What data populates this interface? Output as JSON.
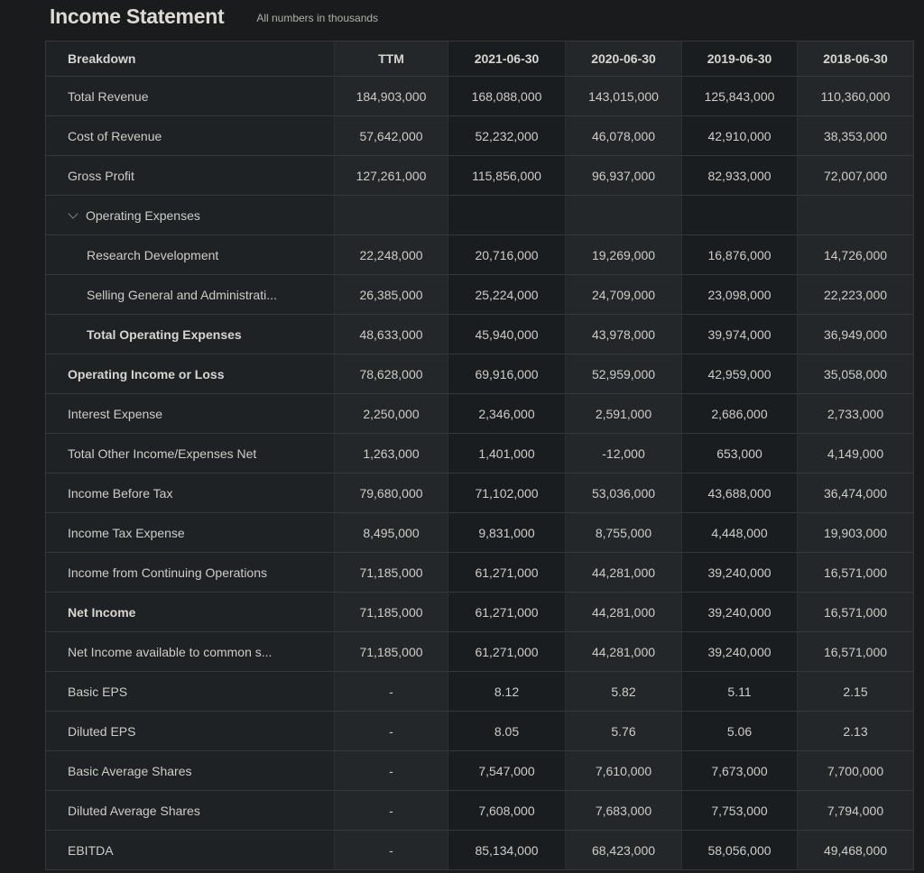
{
  "header": {
    "title": "Income Statement",
    "units_note": "All numbers in thousands"
  },
  "colors": {
    "page_background": "#191b1c",
    "column_shade_light": "#242729",
    "column_shade_dark": "#1a1d20",
    "label_column_background": "#1e2225",
    "row_divider": "#34383c",
    "text": "#cfccc6"
  },
  "icons": {
    "section_toggle": "chevron-down"
  },
  "table": {
    "columns": [
      "Breakdown",
      "TTM",
      "2021-06-30",
      "2020-06-30",
      "2019-06-30",
      "2018-06-30"
    ],
    "rows": [
      {
        "label": "Total Revenue",
        "style": "normal",
        "indent": 0,
        "values": [
          "184,903,000",
          "168,088,000",
          "143,015,000",
          "125,843,000",
          "110,360,000"
        ]
      },
      {
        "label": "Cost of Revenue",
        "style": "normal",
        "indent": 0,
        "values": [
          "57,642,000",
          "52,232,000",
          "46,078,000",
          "42,910,000",
          "38,353,000"
        ]
      },
      {
        "label": "Gross Profit",
        "style": "normal",
        "indent": 0,
        "values": [
          "127,261,000",
          "115,856,000",
          "96,937,000",
          "82,933,000",
          "72,007,000"
        ]
      },
      {
        "label": "Operating Expenses",
        "style": "section",
        "indent": 0,
        "values": [
          "",
          "",
          "",
          "",
          ""
        ]
      },
      {
        "label": "Research Development",
        "style": "normal",
        "indent": 1,
        "values": [
          "22,248,000",
          "20,716,000",
          "19,269,000",
          "16,876,000",
          "14,726,000"
        ]
      },
      {
        "label": "Selling General and Administrati...",
        "style": "normal",
        "indent": 1,
        "values": [
          "26,385,000",
          "25,224,000",
          "24,709,000",
          "23,098,000",
          "22,223,000"
        ]
      },
      {
        "label": "Total Operating Expenses",
        "style": "bold",
        "indent": 1,
        "values": [
          "48,633,000",
          "45,940,000",
          "43,978,000",
          "39,974,000",
          "36,949,000"
        ]
      },
      {
        "label": "Operating Income or Loss",
        "style": "bold",
        "indent": 0,
        "values": [
          "78,628,000",
          "69,916,000",
          "52,959,000",
          "42,959,000",
          "35,058,000"
        ]
      },
      {
        "label": "Interest Expense",
        "style": "normal",
        "indent": 0,
        "values": [
          "2,250,000",
          "2,346,000",
          "2,591,000",
          "2,686,000",
          "2,733,000"
        ]
      },
      {
        "label": "Total Other Income/Expenses Net",
        "style": "normal",
        "indent": 0,
        "values": [
          "1,263,000",
          "1,401,000",
          "-12,000",
          "653,000",
          "4,149,000"
        ]
      },
      {
        "label": "Income Before Tax",
        "style": "normal",
        "indent": 0,
        "values": [
          "79,680,000",
          "71,102,000",
          "53,036,000",
          "43,688,000",
          "36,474,000"
        ]
      },
      {
        "label": "Income Tax Expense",
        "style": "normal",
        "indent": 0,
        "values": [
          "8,495,000",
          "9,831,000",
          "8,755,000",
          "4,448,000",
          "19,903,000"
        ]
      },
      {
        "label": "Income from Continuing Operations",
        "style": "normal",
        "indent": 0,
        "values": [
          "71,185,000",
          "61,271,000",
          "44,281,000",
          "39,240,000",
          "16,571,000"
        ]
      },
      {
        "label": "Net Income",
        "style": "bold",
        "indent": 0,
        "values": [
          "71,185,000",
          "61,271,000",
          "44,281,000",
          "39,240,000",
          "16,571,000"
        ]
      },
      {
        "label": "Net Income available to common s...",
        "style": "normal",
        "indent": 0,
        "values": [
          "71,185,000",
          "61,271,000",
          "44,281,000",
          "39,240,000",
          "16,571,000"
        ]
      },
      {
        "label": "Basic EPS",
        "style": "normal",
        "indent": 0,
        "values": [
          "-",
          "8.12",
          "5.82",
          "5.11",
          "2.15"
        ]
      },
      {
        "label": "Diluted EPS",
        "style": "normal",
        "indent": 0,
        "values": [
          "-",
          "8.05",
          "5.76",
          "5.06",
          "2.13"
        ]
      },
      {
        "label": "Basic Average Shares",
        "style": "normal",
        "indent": 0,
        "values": [
          "-",
          "7,547,000",
          "7,610,000",
          "7,673,000",
          "7,700,000"
        ]
      },
      {
        "label": "Diluted Average Shares",
        "style": "normal",
        "indent": 0,
        "values": [
          "-",
          "7,608,000",
          "7,683,000",
          "7,753,000",
          "7,794,000"
        ]
      },
      {
        "label": "EBITDA",
        "style": "normal",
        "indent": 0,
        "values": [
          "-",
          "85,134,000",
          "68,423,000",
          "58,056,000",
          "49,468,000"
        ]
      }
    ]
  }
}
